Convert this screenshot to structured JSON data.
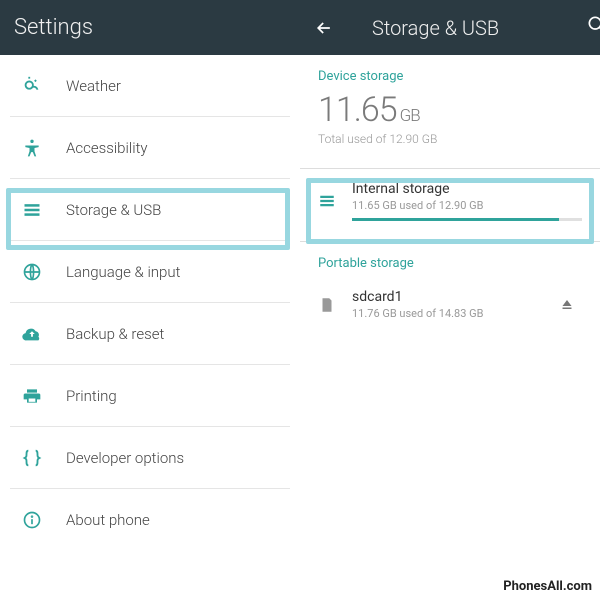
{
  "left": {
    "header": "Settings",
    "items": [
      {
        "label": "Weather"
      },
      {
        "label": "Accessibility"
      },
      {
        "label": "Storage & USB"
      },
      {
        "label": "Language & input"
      },
      {
        "label": "Backup & reset"
      },
      {
        "label": "Printing"
      },
      {
        "label": "Developer options"
      },
      {
        "label": "About phone"
      }
    ]
  },
  "right": {
    "header": "Storage & USB",
    "device_section": "Device storage",
    "total_value": "11.65",
    "total_unit": "GB",
    "total_sub": "Total used of 12.90 GB",
    "internal": {
      "title": "Internal storage",
      "sub": "11.65 GB used of 12.90 GB",
      "fill_pct": 90
    },
    "portable_section": "Portable storage",
    "sdcard": {
      "title": "sdcard1",
      "sub": "11.76 GB used of 14.83 GB"
    }
  },
  "watermark": "PhonesAll.com"
}
